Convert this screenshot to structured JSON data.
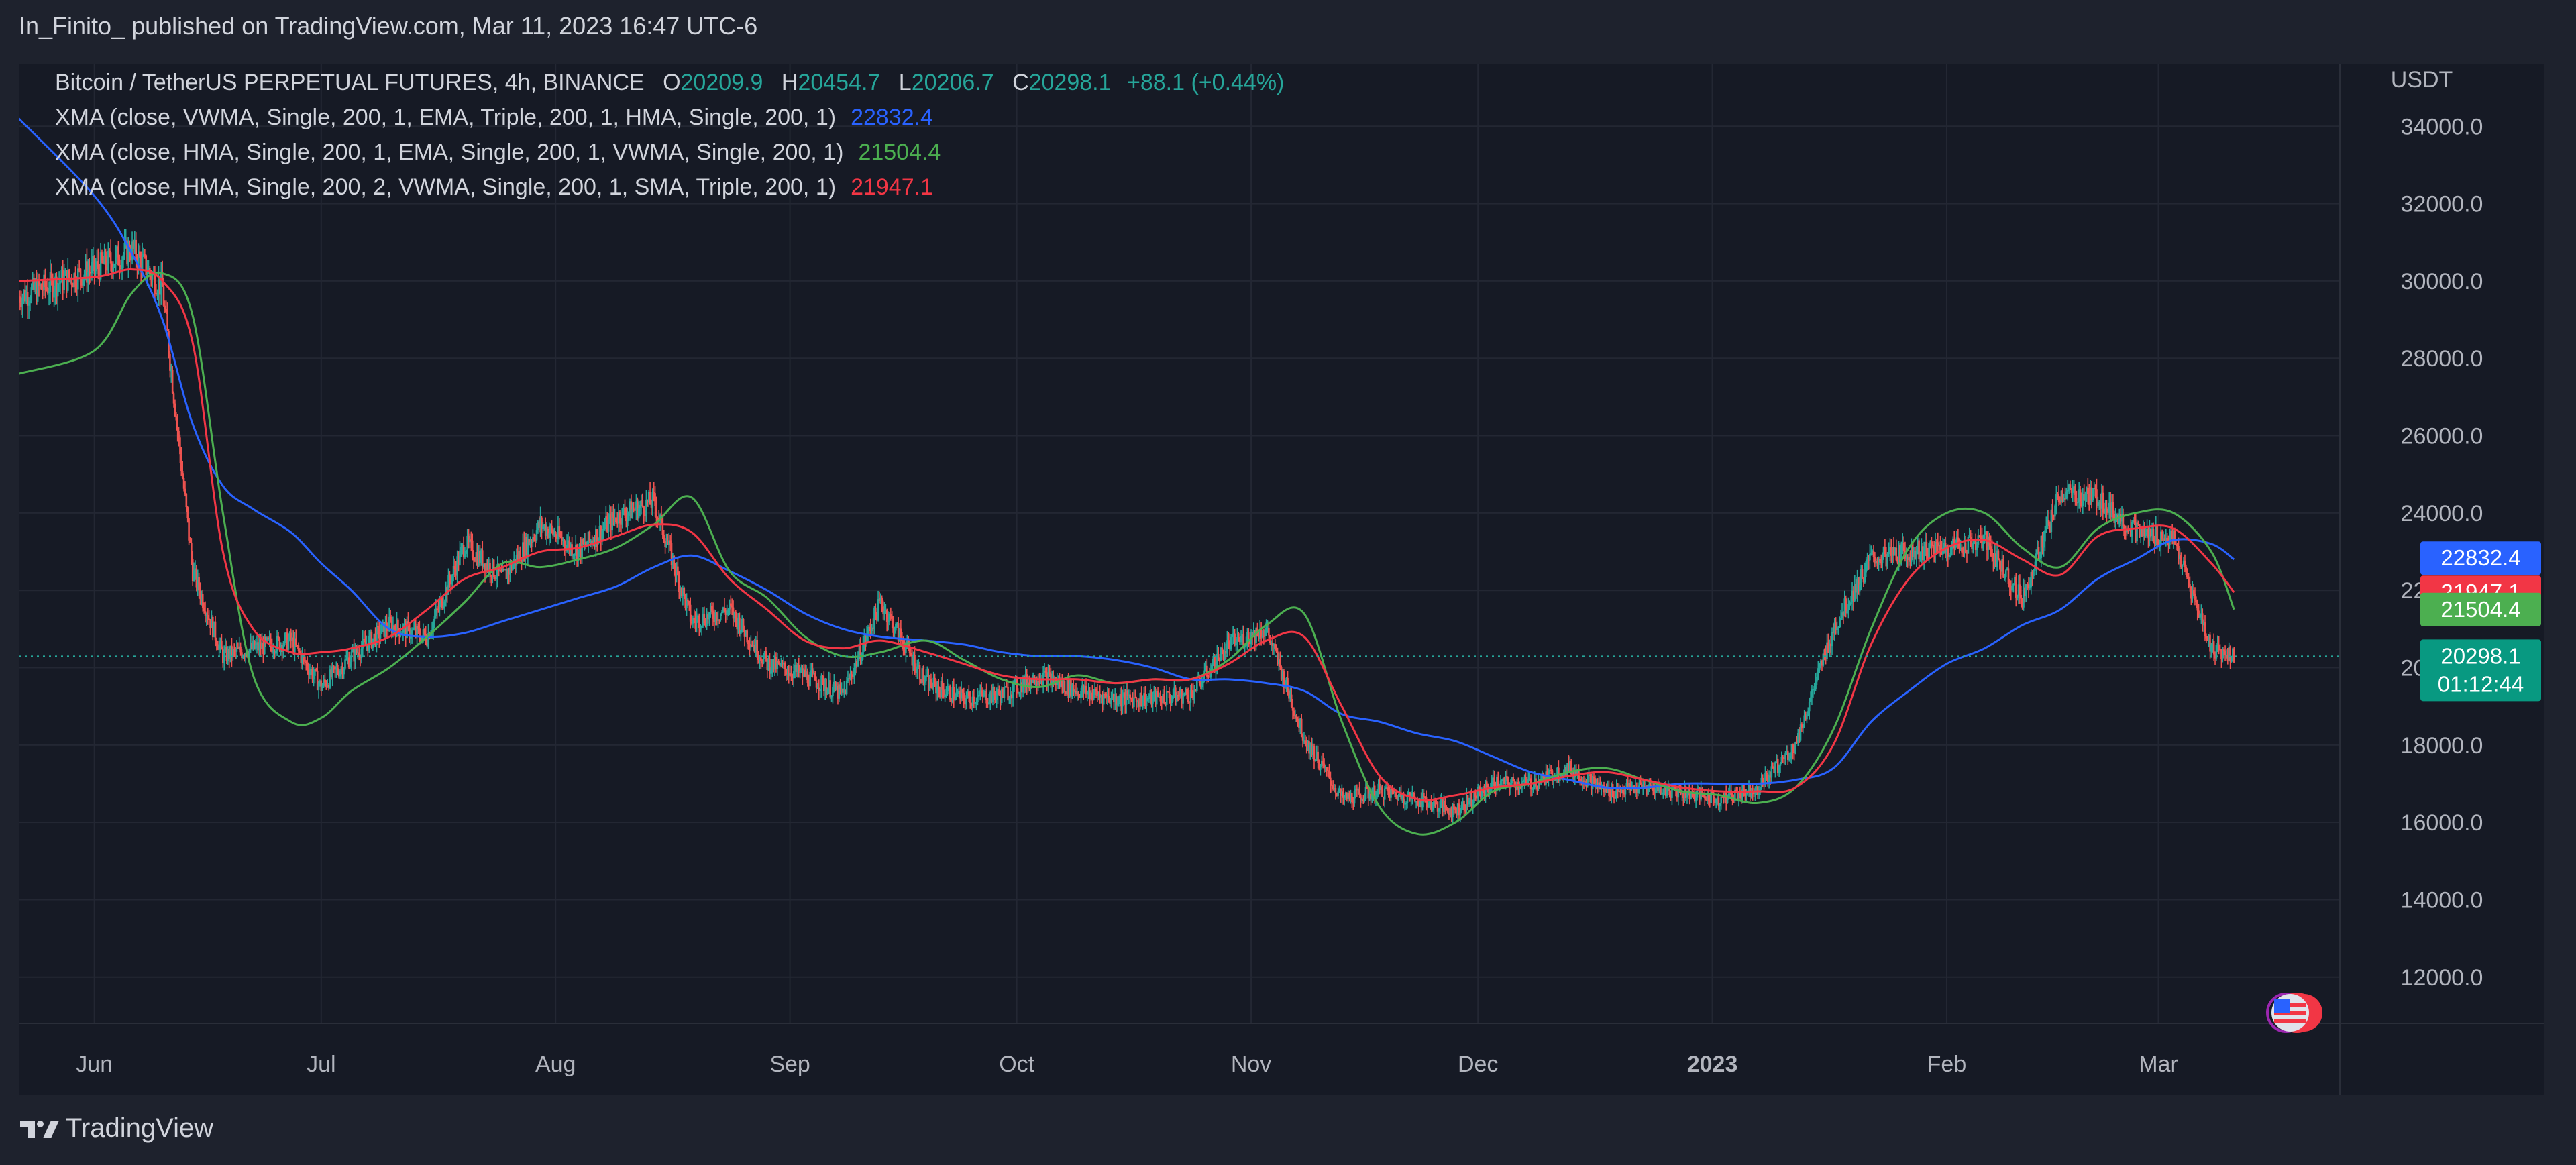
{
  "publisher": "In_Finito_ published on TradingView.com, Mar 11, 2023 16:47 UTC-6",
  "brand": "TradingView",
  "legend": {
    "symbol": "Bitcoin / TetherUS PERPETUAL FUTURES, 4h, BINANCE",
    "open_label": "O",
    "open": "20209.9",
    "high_label": "H",
    "high": "20454.7",
    "low_label": "L",
    "low": "20206.7",
    "close_label": "C",
    "close": "20298.1",
    "change": "+88.1 (+0.44%)",
    "indicators": [
      {
        "label": "XMA (close, VWMA, Single, 200, 1, EMA, Triple, 200, 1, HMA, Single, 200, 1)",
        "value": "22832.4",
        "color": "#2962ff"
      },
      {
        "label": "XMA (close, HMA, Single, 200, 1, EMA, Single, 200, 1, VWMA, Single, 200, 1)",
        "value": "21504.4",
        "color": "#4caf50"
      },
      {
        "label": "XMA (close, HMA, Single, 200, 2, VWMA, Single, 200, 1, SMA, Triple, 200, 1)",
        "value": "21947.1",
        "color": "#f23645"
      }
    ]
  },
  "price_tags": {
    "blue": "22832.4",
    "red": "21947.1",
    "green": "21504.4",
    "last": "20298.1",
    "countdown": "01:12:44"
  },
  "colors": {
    "up": "#26a69a",
    "down": "#ef5350",
    "blue": "#2962ff",
    "green": "#4caf50",
    "red": "#f23645",
    "grid": "#232733",
    "text": "#b2b5be"
  },
  "chart_data": {
    "type": "line",
    "title": "Bitcoin / TetherUS PERPETUAL FUTURES, 4h, BINANCE",
    "y_axis_unit": "USDT",
    "y_ticks": [
      12000,
      14000,
      16000,
      18000,
      20000,
      22000,
      24000,
      26000,
      28000,
      30000,
      32000,
      34000
    ],
    "ylim": [
      10800,
      35600
    ],
    "x_ticks": [
      "Jun",
      "Jul",
      "Aug",
      "Sep",
      "Oct",
      "Nov",
      "Dec",
      "2023",
      "Feb",
      "Mar"
    ],
    "x_tick_dates": [
      "2022-06-01",
      "2022-07-01",
      "2022-08-01",
      "2022-09-01",
      "2022-10-01",
      "2022-11-01",
      "2022-12-01",
      "2023-01-01",
      "2023-02-01",
      "2023-03-01"
    ],
    "x": [
      "2022-05-22",
      "2022-06-01",
      "2022-06-06",
      "2022-06-10",
      "2022-06-14",
      "2022-06-18",
      "2022-06-22",
      "2022-06-27",
      "2022-07-01",
      "2022-07-05",
      "2022-07-10",
      "2022-07-15",
      "2022-07-20",
      "2022-07-25",
      "2022-07-30",
      "2022-08-04",
      "2022-08-09",
      "2022-08-14",
      "2022-08-19",
      "2022-08-24",
      "2022-08-29",
      "2022-09-03",
      "2022-09-08",
      "2022-09-13",
      "2022-09-19",
      "2022-09-24",
      "2022-09-29",
      "2022-10-04",
      "2022-10-09",
      "2022-10-14",
      "2022-10-19",
      "2022-10-24",
      "2022-10-29",
      "2022-11-03",
      "2022-11-08",
      "2022-11-13",
      "2022-11-18",
      "2022-11-23",
      "2022-11-28",
      "2022-12-03",
      "2022-12-08",
      "2022-12-13",
      "2022-12-18",
      "2022-12-23",
      "2022-12-28",
      "2023-01-02",
      "2023-01-07",
      "2023-01-12",
      "2023-01-17",
      "2023-01-22",
      "2023-01-27",
      "2023-02-01",
      "2023-02-06",
      "2023-02-11",
      "2023-02-16",
      "2023-02-21",
      "2023-02-26",
      "2023-03-03",
      "2023-03-08",
      "2023-03-11"
    ],
    "series": [
      {
        "name": "Price",
        "color": "#26a69a",
        "values": [
          29600,
          30300,
          30800,
          29800,
          22500,
          20300,
          20500,
          20700,
          19500,
          20300,
          21100,
          20800,
          23200,
          22300,
          23700,
          23000,
          23900,
          24300,
          21200,
          21500,
          20100,
          19800,
          19300,
          21700,
          19600,
          19200,
          19300,
          19800,
          19400,
          19200,
          19200,
          19300,
          20600,
          21000,
          18200,
          16600,
          16800,
          16600,
          16300,
          17000,
          17000,
          17400,
          16800,
          16900,
          16800,
          16600,
          16900,
          18000,
          21000,
          22800,
          23000,
          23100,
          23300,
          21800,
          24500,
          24400,
          23500,
          23300,
          20500,
          20298
        ]
      },
      {
        "name": "XMA 22832.4",
        "color": "#2962ff",
        "values": [
          34200,
          32200,
          30700,
          29000,
          26300,
          24700,
          24100,
          23500,
          22700,
          22000,
          21000,
          20800,
          20900,
          21200,
          21500,
          21800,
          22100,
          22600,
          22900,
          22500,
          22000,
          21400,
          21000,
          20800,
          20700,
          20600,
          20400,
          20300,
          20300,
          20200,
          20000,
          19700,
          19700,
          19600,
          19400,
          18800,
          18600,
          18300,
          18100,
          17700,
          17300,
          17100,
          16900,
          16900,
          17000,
          17000,
          17000,
          17100,
          17400,
          18600,
          19400,
          20100,
          20500,
          21100,
          21500,
          22300,
          22800,
          23300,
          23200,
          22800
        ]
      },
      {
        "name": "XMA 21504.4",
        "color": "#4caf50",
        "values": [
          27600,
          28200,
          29700,
          30200,
          29100,
          24000,
          19800,
          18600,
          18700,
          19400,
          20000,
          20800,
          21700,
          22700,
          22600,
          22800,
          23100,
          23700,
          24400,
          22500,
          21800,
          20800,
          20300,
          20400,
          20700,
          20200,
          19700,
          19500,
          19800,
          19600,
          19700,
          19700,
          20200,
          21100,
          21400,
          18600,
          16400,
          15700,
          16000,
          16800,
          17000,
          17300,
          17400,
          17100,
          16800,
          16700,
          16500,
          16900,
          18400,
          21000,
          23100,
          24000,
          24000,
          23100,
          22600,
          23600,
          24000,
          24000,
          23000,
          21504
        ]
      },
      {
        "name": "XMA 21947.1",
        "color": "#f23645",
        "values": [
          30000,
          30100,
          30300,
          30000,
          28400,
          23000,
          21000,
          20400,
          20400,
          20500,
          20800,
          21500,
          22300,
          22600,
          23000,
          23100,
          23400,
          23700,
          23500,
          22300,
          21500,
          20700,
          20500,
          20700,
          20400,
          20100,
          19800,
          19700,
          19700,
          19600,
          19700,
          19700,
          20100,
          20700,
          20800,
          19000,
          17200,
          16600,
          16700,
          16900,
          17000,
          17200,
          17300,
          17100,
          16900,
          16800,
          16800,
          16900,
          18000,
          20600,
          22300,
          23100,
          23300,
          22800,
          22400,
          23400,
          23600,
          23600,
          22700,
          21947
        ]
      }
    ]
  }
}
